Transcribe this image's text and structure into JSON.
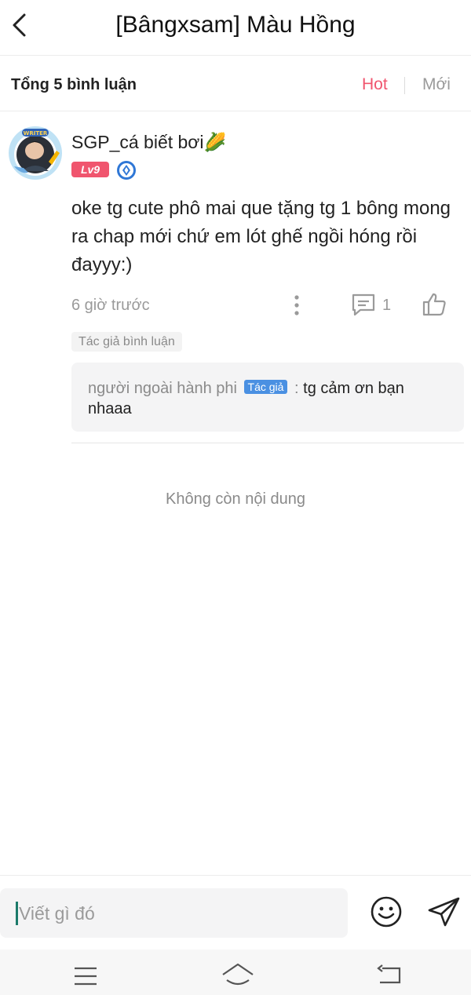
{
  "header": {
    "title": "[Bângxsam] Màu Hồng"
  },
  "comments_bar": {
    "count_label": "Tổng 5 bình luận",
    "sort_hot": "Hot",
    "sort_new": "Mới",
    "hot_color": "#f0556e"
  },
  "comment": {
    "username": "SGP_cá biết bơi🌽",
    "level": "Lv9",
    "text": "oke tg cute phô mai que tặng tg 1 bông mong ra chap mới chứ em lót ghế ngồi hóng rồi đayyy:)",
    "time": "6 giờ trước",
    "reply_count": "1",
    "author_tag": "Tác giả bình luận",
    "reply": {
      "author": "người ngoài hành phi",
      "badge": "Tác giả",
      "separator": ":",
      "text": "tg cảm ơn bạn nhaaa"
    }
  },
  "end_text": "Không còn nội dung",
  "composer": {
    "placeholder": "Viết gì đó"
  }
}
